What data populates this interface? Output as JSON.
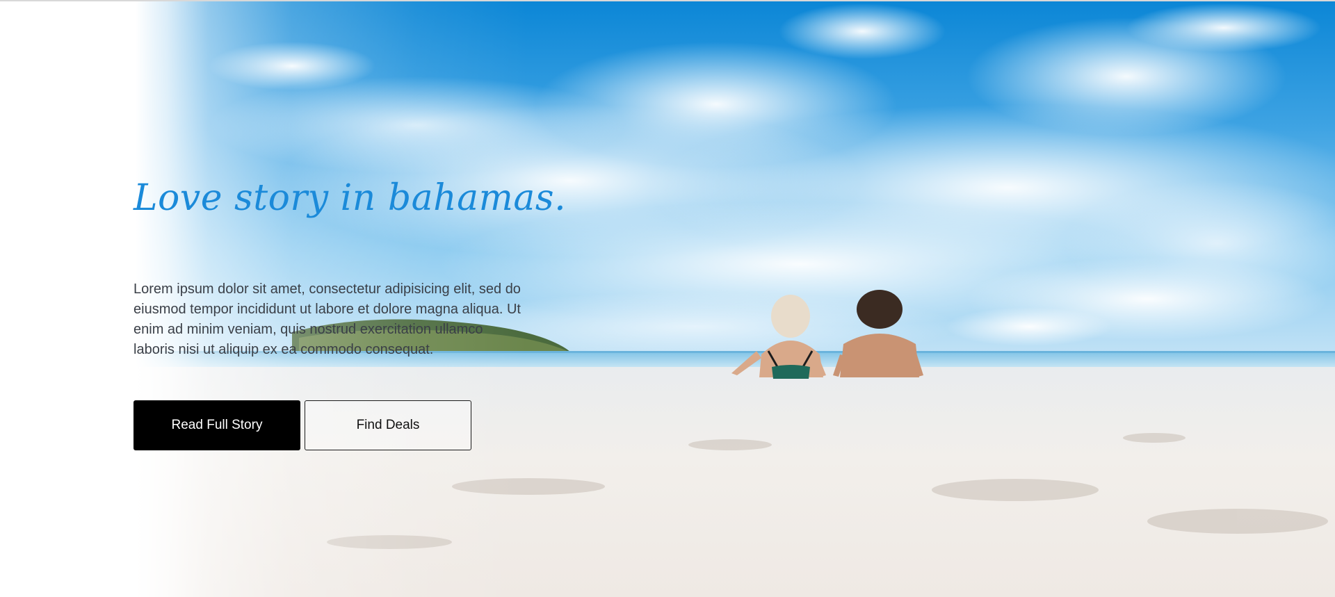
{
  "hero": {
    "headline": "Love story in bahamas.",
    "intro": "Lorem ipsum dolor sit amet, consectetur adipisicing elit, sed do eiusmod tempor incididunt ut labore et dolore magna aliqua. Ut enim ad minim veniam, quis nostrud exercitation ullamco laboris nisi ut aliquip ex ea commodo consequat.",
    "buttons": {
      "primary_label": "Read Full Story",
      "secondary_label": "Find Deals"
    },
    "background_image": "beach-couple-photo"
  },
  "colors": {
    "headline": "#1b8ad9",
    "sky_deep": "#0a8ad6",
    "sand": "#f1eeea",
    "primary_button": "#000000"
  }
}
